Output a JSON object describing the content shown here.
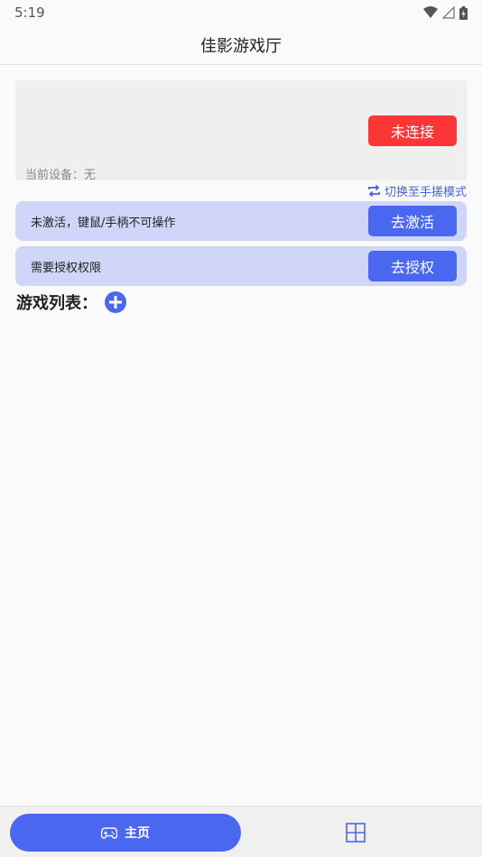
{
  "status": {
    "time": "5:19",
    "icons": [
      "wifi-icon",
      "signal-icon",
      "battery-icon"
    ]
  },
  "app": {
    "title": "佳影游戏厅"
  },
  "device": {
    "connect_label": "未连接",
    "current_device": "当前设备：无"
  },
  "mode": {
    "switch_label": "切换至手搓模式",
    "icon": "swap-icon"
  },
  "notices": [
    {
      "text": "未激活，键鼠/手柄不可操作",
      "button": "去激活"
    },
    {
      "text": "需要授权权限",
      "button": "去授权"
    }
  ],
  "games": {
    "heading": "游戏列表：",
    "add_icon": "plus-circle-icon"
  },
  "nav": {
    "home_label": "主页",
    "home_icon": "gamepad-icon",
    "grid_icon": "grid-icon"
  },
  "colors": {
    "accent": "#4a67f0",
    "danger": "#fb3636",
    "notice_bg": "#cfd6f8"
  }
}
